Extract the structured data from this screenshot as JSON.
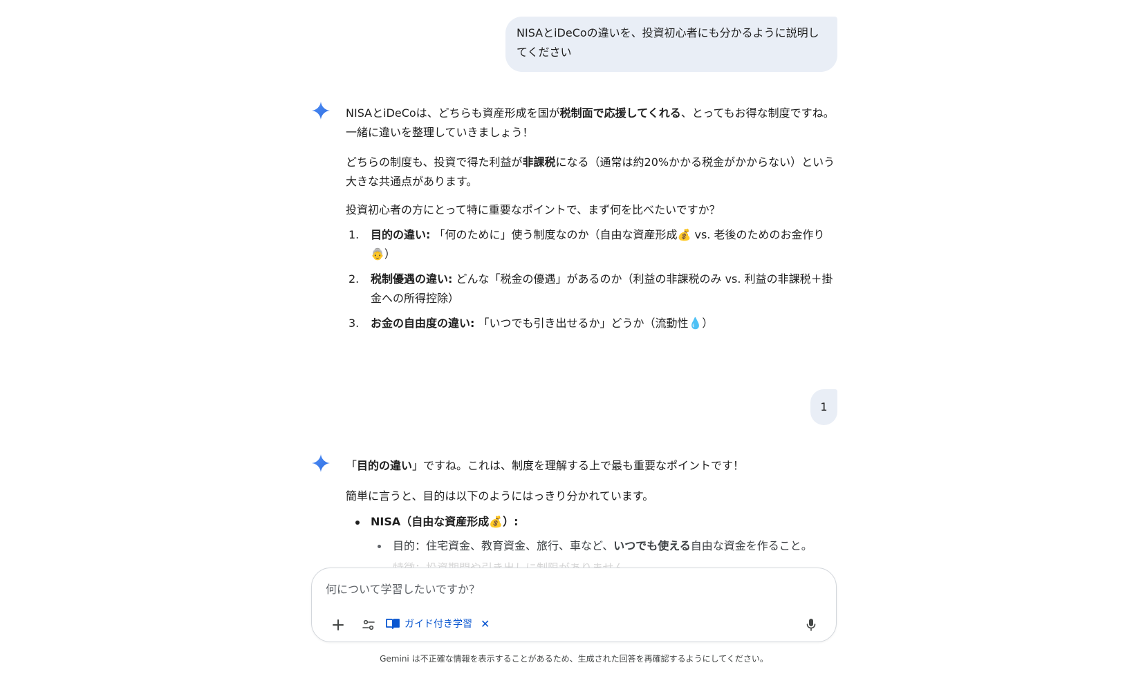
{
  "conversation": {
    "user_message_1": "NISAとiDeCoの違いを、投資初心者にも分かるように説明してください",
    "response_1": {
      "intro_a": "NISAとiDeCoは、どちらも資産形成を国が",
      "intro_bold": "税制面で応援してくれる",
      "intro_b": "、とってもお得な制度ですね。一緒に違いを整理していきましょう！",
      "common_a": "どちらの制度も、投資で得た利益が",
      "common_bold": "非課税",
      "common_b": "になる（通常は約20%かかる税金がかからない）という大きな共通点があります。",
      "question": "投資初心者の方にとって特に重要なポイントで、まず何を比べたいですか？",
      "options": [
        {
          "num": "1.",
          "title": "目的の違い:",
          "text": "「何のために」使う制度なのか（自由な資産形成💰 vs. 老後のためのお金作り👵）"
        },
        {
          "num": "2.",
          "title": "税制優遇の違い:",
          "text": "どんな「税金の優遇」があるのか（利益の非課税のみ vs. 利益の非課税＋掛金への所得控除）"
        },
        {
          "num": "3.",
          "title": "お金の自由度の違い:",
          "text": "「いつでも引き出せるか」どうか（流動性💧）"
        }
      ]
    },
    "user_message_2": "1",
    "response_2": {
      "lead_open": "「",
      "lead_bold": "目的の違い",
      "lead_rest": "」ですね。これは、制度を理解する上で最も重要なポイントです！",
      "summary": "簡単に言うと、目的は以下のようにはっきり分かれています。",
      "nisa_heading": "NISA（自由な資産形成💰）:",
      "nisa_purpose_a": "目的：住宅資金、教育資金、旅行、車など、",
      "nisa_purpose_bold": "いつでも使える",
      "nisa_purpose_b": "自由な資金を作ること。",
      "nisa_feature_partial": "特徴：投資期間や引き出しに制限がありません"
    }
  },
  "input": {
    "placeholder": "何について学習したいですか？",
    "guided_chip_label": "ガイド付き学習",
    "add_icon": "plus-icon",
    "tools_icon": "tune-icon",
    "mic_icon": "mic-icon"
  },
  "disclaimer": "Gemini は不正確な情報を表示することがあるため、生成された回答を再確認するようにしてください。",
  "colors": {
    "user_bubble": "#e9eef6",
    "accent_blue": "#0b57d0",
    "gemini_spark": "#4285f4"
  }
}
